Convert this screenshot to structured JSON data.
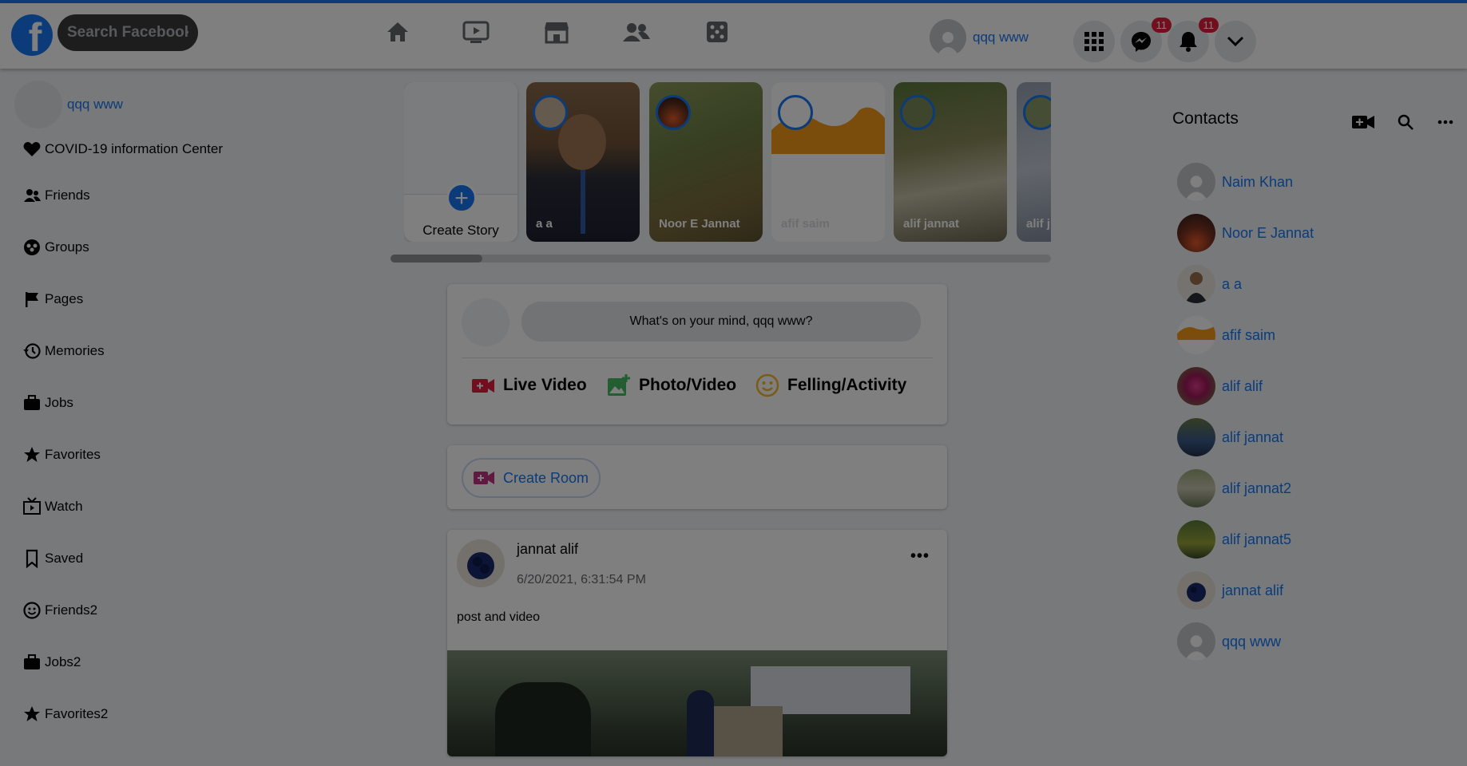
{
  "header": {
    "search_placeholder": "Search Facebook",
    "nav_icons": [
      "home-icon",
      "watch-icon",
      "marketplace-icon",
      "groups-icon",
      "gaming-icon"
    ],
    "profile_name": "qqq www",
    "messenger_badge": "11",
    "notifications_badge": "11"
  },
  "sidebar": {
    "profile_name": "qqq www",
    "items": [
      {
        "label": "COVID-19 information Center",
        "icon": "heart-icon"
      },
      {
        "label": "Friends",
        "icon": "friends-icon"
      },
      {
        "label": "Groups",
        "icon": "groups-icon"
      },
      {
        "label": "Pages",
        "icon": "flag-icon"
      },
      {
        "label": "Memories",
        "icon": "history-icon"
      },
      {
        "label": "Jobs",
        "icon": "briefcase-icon"
      },
      {
        "label": "Favorites",
        "icon": "star-icon"
      },
      {
        "label": "Watch",
        "icon": "tv-icon"
      },
      {
        "label": "Saved",
        "icon": "bookmark-icon"
      },
      {
        "label": "Friends2",
        "icon": "smiley-icon"
      },
      {
        "label": "Jobs2",
        "icon": "briefcase-icon"
      },
      {
        "label": "Favorites2",
        "icon": "star-icon"
      }
    ]
  },
  "stories": {
    "create_label": "Create Story",
    "items": [
      {
        "label": "a a"
      },
      {
        "label": "Noor E Jannat"
      },
      {
        "label": "afif saim"
      },
      {
        "label": "alif jannat"
      },
      {
        "label": "alif j"
      }
    ],
    "scroll_position": 0.05
  },
  "composer": {
    "placeholder": "What's on your mind, qqq www?",
    "live_video": "Live Video",
    "photo_video": "Photo/Video",
    "feeling_activity": "Felling/Activity"
  },
  "room": {
    "label": "Create Room"
  },
  "post": {
    "author": "jannat alif",
    "timestamp": "6/20/2021, 6:31:54 PM",
    "text": "post and video",
    "more": "•••"
  },
  "contacts": {
    "title": "Contacts",
    "items": [
      {
        "name": "Naim Khan"
      },
      {
        "name": "Noor E Jannat"
      },
      {
        "name": "a a"
      },
      {
        "name": "afif saim"
      },
      {
        "name": "alif alif"
      },
      {
        "name": "alif jannat"
      },
      {
        "name": "alif jannat2"
      },
      {
        "name": "alif jannat5"
      },
      {
        "name": "jannat alif"
      },
      {
        "name": "qqq www"
      }
    ]
  },
  "colors": {
    "brand": "#1877f2",
    "badge": "#e41e3f",
    "overlay": "rgba(0,0,0,0.5)"
  }
}
